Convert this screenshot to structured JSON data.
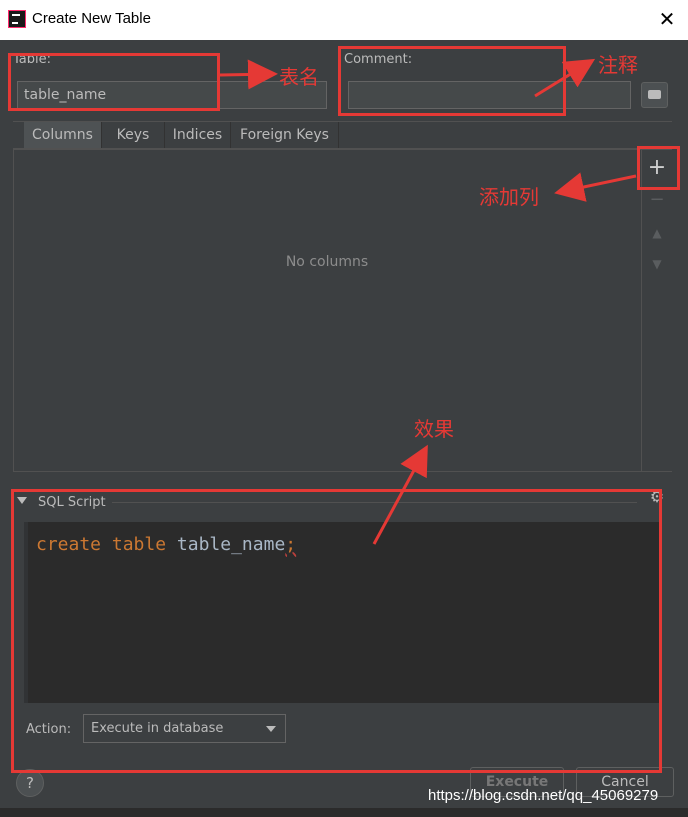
{
  "window": {
    "title": "Create New Table"
  },
  "form": {
    "table_label": "Table:",
    "table_value": "table_name",
    "comment_label": "Comment:",
    "comment_value": ""
  },
  "tabs": [
    "Columns",
    "Keys",
    "Indices",
    "Foreign Keys"
  ],
  "columns_panel": {
    "empty_text": "No columns"
  },
  "toolbar": {
    "add": "+",
    "remove": "−",
    "up": "▲",
    "down": "▼"
  },
  "sql_script": {
    "header": "SQL Script",
    "code": {
      "kw1": "create",
      "kw2": "table",
      "name": "table_name",
      "semi": ";"
    }
  },
  "action": {
    "label": "Action:",
    "selected": "Execute in database"
  },
  "buttons": {
    "execute": "Execute",
    "cancel": "Cancel",
    "help": "?"
  },
  "annotations": {
    "table_name": "表名",
    "comment": "注释",
    "add_column": "添加列",
    "result": "效果"
  },
  "watermark": "https://blog.csdn.net/qq_45069279",
  "colors": {
    "annotation": "#e53935",
    "keyword": "#cc7832",
    "identifier": "#a9b7c6"
  }
}
